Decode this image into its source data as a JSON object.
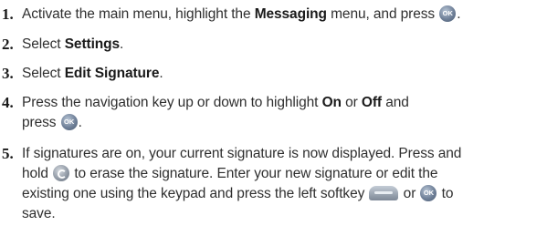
{
  "steps": [
    {
      "number": "1.",
      "segments": [
        {
          "t": "Activate the main menu, highlight the "
        },
        {
          "t": "Messaging",
          "b": true
        },
        {
          "t": " menu, and press "
        },
        {
          "icon": "ok-key-icon"
        },
        {
          "t": "."
        }
      ]
    },
    {
      "number": "2.",
      "segments": [
        {
          "t": "Select "
        },
        {
          "t": "Settings",
          "b": true
        },
        {
          "t": "."
        }
      ]
    },
    {
      "number": "3.",
      "segments": [
        {
          "t": "Select "
        },
        {
          "t": "Edit Signature",
          "b": true
        },
        {
          "t": "."
        }
      ]
    },
    {
      "number": "4.",
      "segments": [
        {
          "t": "Press the navigation key up or down to highlight "
        },
        {
          "t": "On",
          "b": true
        },
        {
          "t": " or "
        },
        {
          "t": "Off",
          "b": true
        },
        {
          "t": " and"
        },
        {
          "br": true
        },
        {
          "t": "press "
        },
        {
          "icon": "ok-key-icon"
        },
        {
          "t": "."
        }
      ]
    },
    {
      "number": "5.",
      "segments": [
        {
          "t": "If signatures are on, your current signature is now displayed. Press and"
        },
        {
          "br": true
        },
        {
          "t": "hold "
        },
        {
          "icon": "clear-key-icon"
        },
        {
          "t": " to erase the signature. Enter your new signature or edit the"
        },
        {
          "br": true
        },
        {
          "t": "existing one using the keypad and press the left softkey "
        },
        {
          "icon": "left-softkey-icon"
        },
        {
          "t": " or "
        },
        {
          "icon": "ok-key-icon"
        },
        {
          "t": " to"
        },
        {
          "br": true
        },
        {
          "t": "save."
        }
      ]
    }
  ],
  "icons": {
    "ok-key-icon": {
      "label": "OK"
    },
    "clear-key-icon": {
      "label": ""
    },
    "left-softkey-icon": {
      "label": ""
    }
  }
}
